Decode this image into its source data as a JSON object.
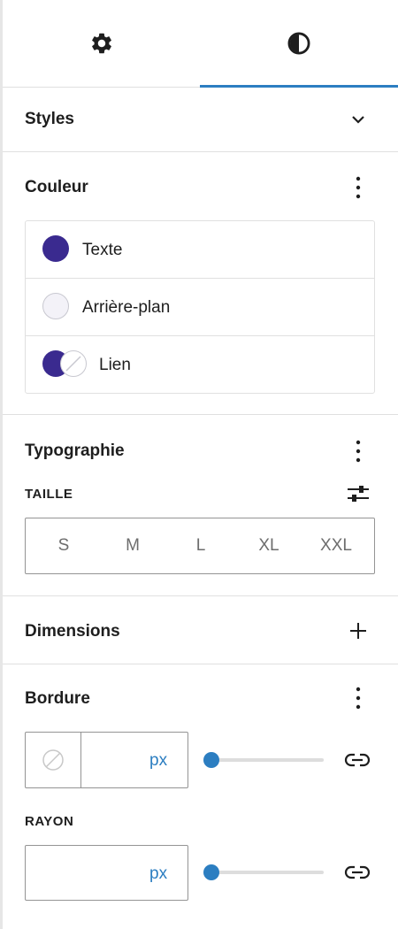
{
  "tabs": [
    {
      "name": "settings",
      "icon": "gear-icon"
    },
    {
      "name": "styles",
      "icon": "half-contrast-icon",
      "active": true
    }
  ],
  "styles": {
    "title": "Styles"
  },
  "color": {
    "title": "Couleur",
    "items": [
      {
        "label": "Texte",
        "swatch": "#3a2a8f"
      },
      {
        "label": "Arrière-plan",
        "swatch": "#f3f2f8"
      },
      {
        "label": "Lien",
        "swatch": "#3a2a8f"
      }
    ]
  },
  "typography": {
    "title": "Typographie",
    "size_label": "TAILLE",
    "sizes": [
      "S",
      "M",
      "L",
      "XL",
      "XXL"
    ]
  },
  "dimensions": {
    "title": "Dimensions"
  },
  "border": {
    "title": "Bordure",
    "width_unit": "px",
    "width_value": 0,
    "radius_label": "RAYON",
    "radius_unit": "px",
    "radius_value": 0
  },
  "colors": {
    "accent": "#2c7ec1",
    "swatch_dark": "#3a2a8f"
  }
}
